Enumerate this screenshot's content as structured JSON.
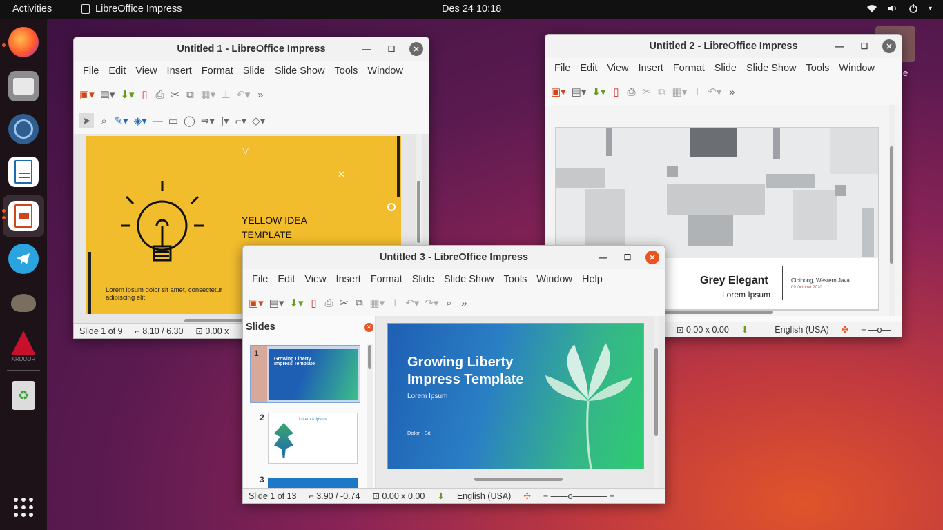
{
  "topbar": {
    "activities": "Activities",
    "app": "LibreOffice Impress",
    "clock": "Des 24  10:18",
    "wifi": "▾",
    "vol": "🔊",
    "power": "⏻"
  },
  "dock": {
    "items": [
      "firefox-icon",
      "files-icon",
      "budgie-icon",
      "writer-icon",
      "impress-icon",
      "telegram-icon",
      "gimp-icon",
      "ardour-icon",
      "trash-icon",
      "apps-grid-icon"
    ]
  },
  "menus": [
    "File",
    "Edit",
    "View",
    "Insert",
    "Format",
    "Slide",
    "Slide Show",
    "Tools",
    "Window"
  ],
  "menus3": [
    "File",
    "Edit",
    "View",
    "Insert",
    "Format",
    "Slide",
    "Slide Show",
    "Tools",
    "Window",
    "Help"
  ],
  "win1": {
    "title": "Untitled 1 - LibreOffice Impress",
    "slide_title": "YELLOW IDEA\nTEMPLATE",
    "slide_body": "Lorem ipsum dolor sit amet, consectetur adipiscing elit.",
    "status": {
      "slide": "Slide 1 of 9",
      "pos": "8.10 / 6.30",
      "size": "0.00 x"
    }
  },
  "win2": {
    "title": "Untitled 2 - LibreOffice Impress",
    "slide_title": "Grey Elegant",
    "slide_sub": "Lorem Ipsum",
    "loc": "Cibinong, Western Java",
    "date": "09 October 2020",
    "status": {
      "size": "0.00 x 0.00",
      "lang": "English (USA)"
    }
  },
  "win3": {
    "title": "Untitled 3 - LibreOffice Impress",
    "panel_title": "Slides",
    "thumbs": [
      "1",
      "2",
      "3"
    ],
    "thumb1_title": "Growing Liberty Impress Template",
    "thumb2_title": "Lorem & Ipsum",
    "slide_title": "Growing Liberty\nImpress Template",
    "slide_sub": "Lorem Ipsum",
    "slide_foot": "Dolor - Sit",
    "status": {
      "slide": "Slide 1 of 13",
      "pos": "3.90 / -0.74",
      "size": "0.00 x 0.00",
      "lang": "English (USA)"
    }
  },
  "desktop_label": "e"
}
